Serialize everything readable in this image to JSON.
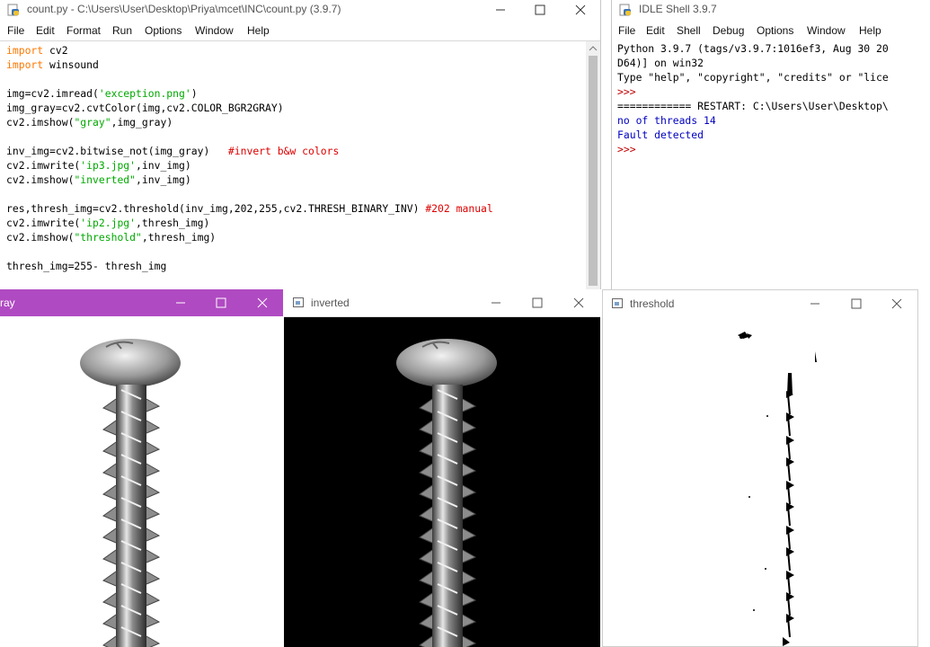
{
  "editor": {
    "title": "count.py - C:\\Users\\User\\Desktop\\Priya\\mcet\\INC\\count.py (3.9.7)",
    "menu": [
      "File",
      "Edit",
      "Format",
      "Run",
      "Options",
      "Window",
      "Help"
    ],
    "lines": [
      [
        {
          "t": "import",
          "c": "kw"
        },
        {
          "t": " cv2"
        }
      ],
      [
        {
          "t": "import",
          "c": "kw"
        },
        {
          "t": " winsound"
        }
      ],
      [],
      [
        {
          "t": "img=cv2.imread("
        },
        {
          "t": "'exception.png'",
          "c": "str"
        },
        {
          "t": ")"
        }
      ],
      [
        {
          "t": "img_gray=cv2.cvtColor(img,cv2.COLOR_BGR2GRAY)"
        }
      ],
      [
        {
          "t": "cv2.imshow("
        },
        {
          "t": "\"gray\"",
          "c": "str"
        },
        {
          "t": ",img_gray)"
        }
      ],
      [],
      [
        {
          "t": "inv_img=cv2.bitwise_not(img_gray)   "
        },
        {
          "t": "#invert b&w colors",
          "c": "cmt"
        }
      ],
      [
        {
          "t": "cv2.imwrite("
        },
        {
          "t": "'ip3.jpg'",
          "c": "str"
        },
        {
          "t": ",inv_img)"
        }
      ],
      [
        {
          "t": "cv2.imshow("
        },
        {
          "t": "\"inverted\"",
          "c": "str"
        },
        {
          "t": ",inv_img)"
        }
      ],
      [],
      [
        {
          "t": "res,thresh_img=cv2.threshold(inv_img,202,255,cv2.THRESH_BINARY_INV) "
        },
        {
          "t": "#202 manual",
          "c": "cmt"
        }
      ],
      [
        {
          "t": "cv2.imwrite("
        },
        {
          "t": "'ip2.jpg'",
          "c": "str"
        },
        {
          "t": ",thresh_img)"
        }
      ],
      [
        {
          "t": "cv2.imshow("
        },
        {
          "t": "\"threshold\"",
          "c": "str"
        },
        {
          "t": ",thresh_img)"
        }
      ],
      [],
      [
        {
          "t": "thresh_img=255- thresh_img"
        }
      ]
    ]
  },
  "shell": {
    "title": "IDLE Shell 3.9.7",
    "menu": [
      "File",
      "Edit",
      "Shell",
      "Debug",
      "Options",
      "Window",
      "Help"
    ],
    "lines": [
      [
        {
          "t": "Python 3.9.7 (tags/v3.9.7:1016ef3, Aug 30 20"
        }
      ],
      [
        {
          "t": "D64)] on win32"
        }
      ],
      [
        {
          "t": "Type \"help\", \"copyright\", \"credits\" or \"lice"
        }
      ],
      [
        {
          "t": ">>>",
          "c": "prompt"
        }
      ],
      [
        {
          "t": "============ RESTART: C:\\Users\\User\\Desktop\\"
        }
      ],
      [
        {
          "t": "no of threads 14",
          "c": "shell-blue"
        }
      ],
      [
        {
          "t": "Fault detected",
          "c": "shell-blue"
        }
      ],
      [
        {
          "t": ">>> ",
          "c": "prompt"
        }
      ]
    ]
  },
  "windows": {
    "gray": {
      "title": "ray"
    },
    "inverted": {
      "title": "inverted"
    },
    "threshold": {
      "title": "threshold"
    }
  },
  "colors": {
    "gray_titlebar": "#b04ac2",
    "syntax_keyword": "#ff7700",
    "syntax_string": "#00aa00",
    "syntax_comment": "#dd0000",
    "shell_output": "#0000c0"
  }
}
